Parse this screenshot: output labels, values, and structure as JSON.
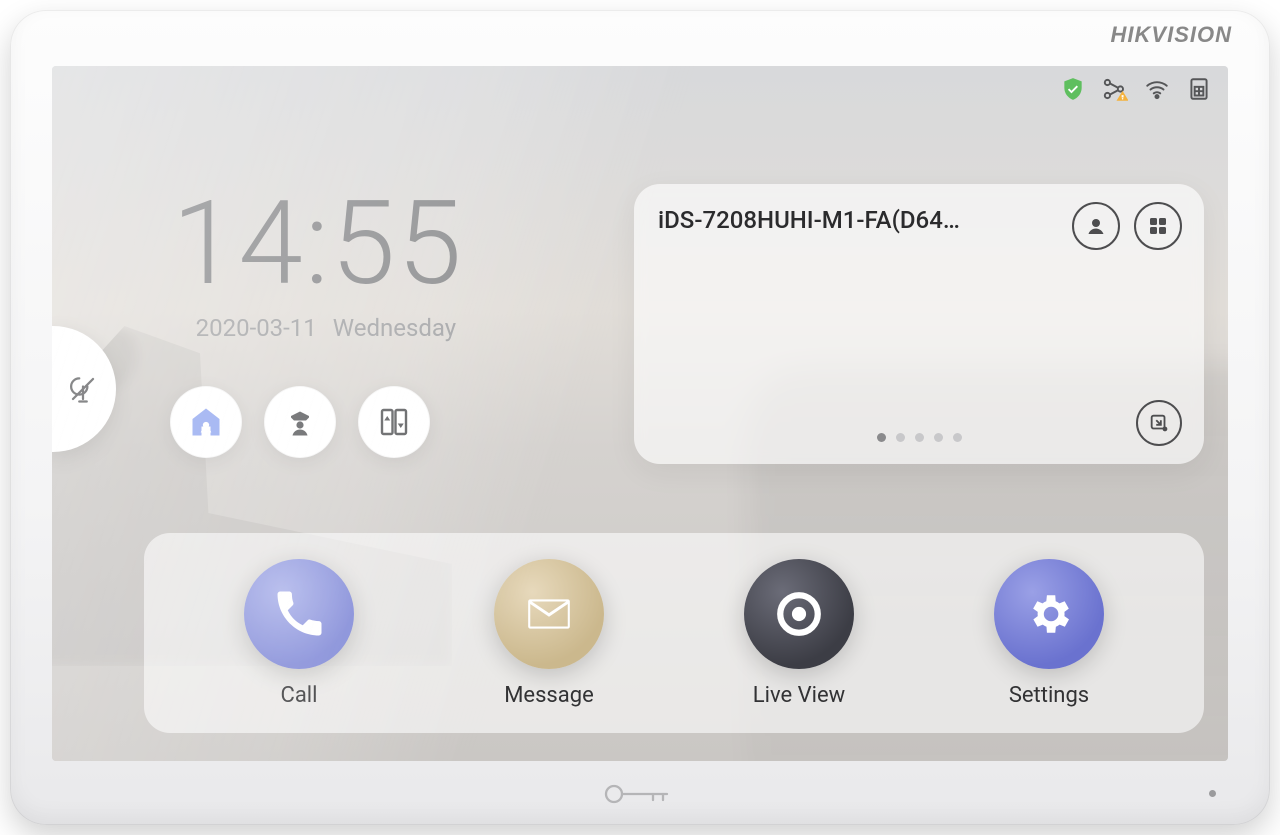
{
  "brand": "HIKVISION",
  "status": {
    "shield_icon": "shield-check",
    "network_icon": "topology-warning",
    "wifi_icon": "wifi",
    "sim_icon": "sim-card",
    "shield_color": "#5fbf5f",
    "icon_color": "#555658"
  },
  "clock": {
    "time": "14:55",
    "date": "2020-03-11",
    "weekday": "Wednesday"
  },
  "quick": {
    "home": "home",
    "guard": "guard",
    "elevator": "elevator"
  },
  "dnd": {
    "icon": "do-not-disturb"
  },
  "device_card": {
    "title": "iDS-7208HUHI-M1-FA(D64…",
    "contacts": "contacts",
    "grid": "grid",
    "minimize": "minimize",
    "page_count": 5,
    "page_index": 0
  },
  "dock": [
    {
      "id": "call",
      "label": "Call",
      "icon": "phone",
      "color": "call"
    },
    {
      "id": "message",
      "label": "Message",
      "icon": "mail",
      "color": "msg"
    },
    {
      "id": "liveview",
      "label": "Live View",
      "icon": "camera",
      "color": "live"
    },
    {
      "id": "settings",
      "label": "Settings",
      "icon": "gear",
      "color": "settings"
    }
  ],
  "hw_key": "unlock-key"
}
